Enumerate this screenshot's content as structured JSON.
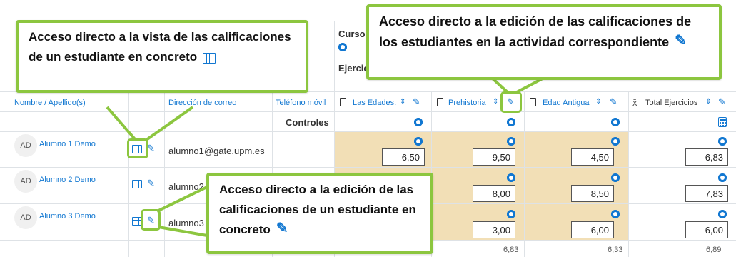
{
  "header_cells": {
    "curso": "Curso",
    "ejercicios": "Ejercicio",
    "col_name": "Nombre / Apellido(s)",
    "col_email": "Dirección de correo",
    "col_phone": "Teléfono móvil",
    "controles": "Controles"
  },
  "grade_items": [
    {
      "label": "Las Edades."
    },
    {
      "label": "Prehistoria"
    },
    {
      "label": "Edad Antigua"
    },
    {
      "label": "Total Ejercicios"
    }
  ],
  "students": [
    {
      "initials": "AD",
      "name": "Alumno 1 Demo",
      "email": "alumno1@gate.upm.es",
      "grades": [
        "6,50",
        "9,50",
        "4,50"
      ],
      "total": "6,83"
    },
    {
      "initials": "AD",
      "name": "Alumno 2 Demo",
      "email": "alumno2",
      "grades": [
        "",
        "8,00",
        "8,50"
      ],
      "total": "7,83"
    },
    {
      "initials": "AD",
      "name": "Alumno 3 Demo",
      "email": "alumno3",
      "grades": [
        "",
        "3,00",
        "6,00"
      ],
      "total": "6,00"
    }
  ],
  "averages": [
    "6,83",
    "6,33",
    "6,89"
  ],
  "callouts": {
    "student_view": "Acceso directo a la vista de las calificaciones de un estudiante en concreto",
    "activity_edit": "Acceso directo a la edición de las calificaciones de los estudiantes en la actividad correspondiente",
    "student_edit": "Acceso directo a la edición de las calificaciones de un estudiante en concreto"
  },
  "colors": {
    "accent": "#1177d1",
    "highlight": "#8cc63f",
    "band": "#f2dfb6"
  }
}
